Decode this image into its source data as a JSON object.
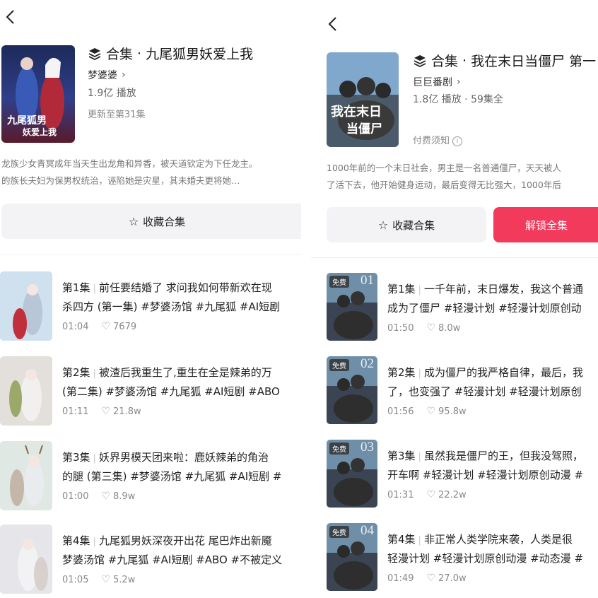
{
  "left": {
    "collection": {
      "prefix": "合集",
      "dot": "·",
      "title": "九尾狐男妖爱上我",
      "author": "梦婆婆",
      "views": "1.9亿 播放",
      "update": "更新至第31集",
      "cover_text_1": "九尾狐男",
      "cover_text_2": "妖爱上我",
      "description_line1": "龙族少女青冥成年当天生出龙角和异香，被天道钦定为下任龙主。",
      "description_line2": "的族长夫妇为保男权统治，诬陷她是灾星，其未婚夫更将她…",
      "favorite_label": "收藏合集"
    },
    "episodes": [
      {
        "num": "第1集",
        "line1": "前任要结婚了 求问我如何带新欢在现",
        "line2": "杀四方 (第一集) #梦婆汤馆 #九尾狐 #AI短剧",
        "duration": "01:04",
        "likes": "7679"
      },
      {
        "num": "第2集",
        "line1": "被渣后我重生了,重生在全是辣弟的万",
        "line2": "(第二集) #梦婆汤馆 #九尾狐 #AI短剧 #ABO",
        "duration": "01:11",
        "likes": "21.8w"
      },
      {
        "num": "第3集",
        "line1": "妖界男模天团来啦：鹿妖辣弟的角治",
        "line2": "的腿 (第三集) #梦婆汤馆 #九尾狐 #AI短剧 #",
        "duration": "01:00",
        "likes": "8.9w"
      },
      {
        "num": "第4集",
        "line1": "九尾狐男妖深夜开出花 尾巴炸出新魇",
        "line2": "梦婆汤馆 #九尾狐 #AI短剧 #ABO #不被定义",
        "duration": "01:05",
        "likes": "5.2w"
      }
    ]
  },
  "right": {
    "collection": {
      "prefix": "合集",
      "dot": "·",
      "title": "我在末日当僵尸 第一",
      "author": "巨巨番剧",
      "views": "1.8亿 播放 · 59集全",
      "payment_notice": "付费须知",
      "cover_text_1": "我在末日",
      "cover_text_2": "当僵尸",
      "description_line1": "1000年前的一个末日社会，男主是一名普通僵尸，天天被人",
      "description_line2": "了活下去，他开始健身运动，最后变得无比强大，1000年后",
      "favorite_label": "收藏合集",
      "unlock_label": "解锁全集"
    },
    "episodes": [
      {
        "badge": "免费",
        "badge_num": "01",
        "num": "第1集",
        "line1": "一千年前，末日爆发，我这个普通",
        "line2": "成为了僵尸 #轻漫计划 #轻漫计划原创动",
        "duration": "01:50",
        "likes": "8.0w"
      },
      {
        "badge": "免费",
        "badge_num": "02",
        "num": "第2集",
        "line1": "成为僵尸的我严格自律，最后，我",
        "line2": "了，也变强了 #轻漫计划 #轻漫计划原创",
        "duration": "01:56",
        "likes": "95.8w"
      },
      {
        "badge": "免费",
        "badge_num": "03",
        "num": "第3集",
        "line1": "虽然我是僵尸的王，但我没驾照，",
        "line2": "开车啊 #轻漫计划 #轻漫计划原创动漫 #",
        "duration": "01:31",
        "likes": "22.2w"
      },
      {
        "badge": "免费",
        "badge_num": "04",
        "num": "第4集",
        "line1": "非正常人类学院来袭，人类是很",
        "line2": "轻漫计划 #轻漫计划原创动漫 #动态漫 #",
        "duration": "01:49",
        "likes": "27.0w"
      }
    ]
  },
  "colors": {
    "accent": "#f23a5c",
    "button_bg": "#f3f3f5",
    "muted": "#888888"
  }
}
